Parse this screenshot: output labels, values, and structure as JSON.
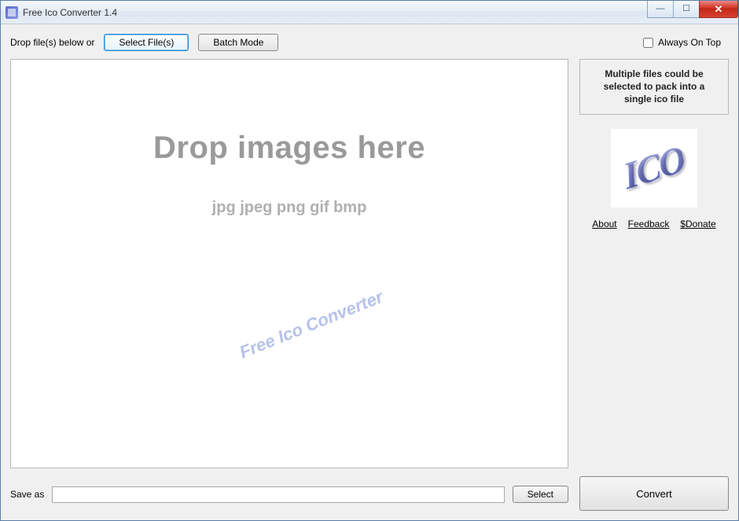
{
  "titlebar": {
    "title": "Free Ico Converter 1.4"
  },
  "toolbar": {
    "drop_label": "Drop file(s) below or",
    "select_files": "Select File(s)",
    "batch_mode": "Batch Mode",
    "always_on_top": "Always On Top"
  },
  "dropzone": {
    "title": "Drop images here",
    "formats": "jpg jpeg png gif bmp",
    "watermark": "Free Ico Converter"
  },
  "sidebar": {
    "tip": "Multiple files could be selected to pack into a single ico file",
    "logo_text": "ICO",
    "links": {
      "about": "About",
      "feedback": "Feedback",
      "donate": "$Donate"
    }
  },
  "saveas": {
    "label": "Save as",
    "path": "",
    "select": "Select"
  },
  "actions": {
    "convert": "Convert"
  }
}
